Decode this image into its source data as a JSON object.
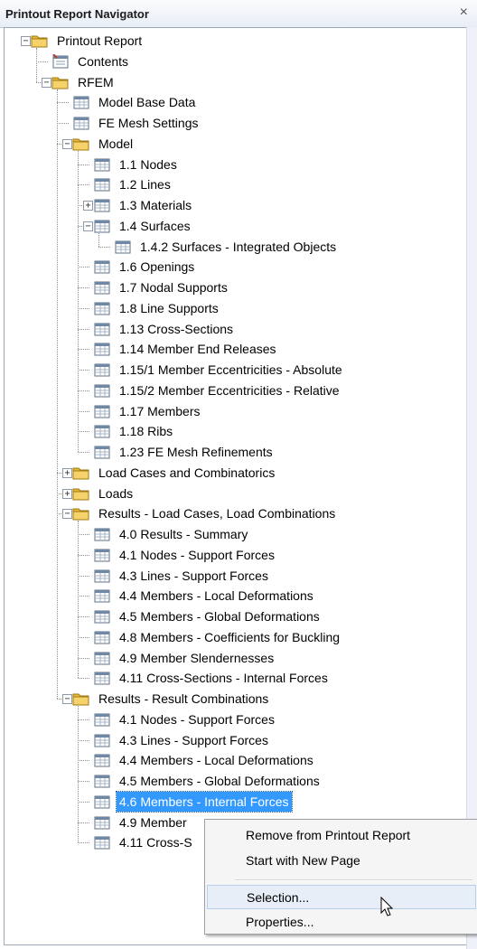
{
  "window": {
    "title": "Printout Report Navigator",
    "close_glyph": "×"
  },
  "tree": [
    {
      "label": "Printout Report",
      "icon": "folder-icon",
      "level": 0,
      "expander": "−"
    },
    {
      "label": "Contents",
      "icon": "contents-icon",
      "level": 1
    },
    {
      "label": "RFEM",
      "icon": "folder-icon",
      "level": 1,
      "expander": "−"
    },
    {
      "label": "Model Base Data",
      "icon": "table-icon",
      "level": 2
    },
    {
      "label": "FE Mesh Settings",
      "icon": "table-icon",
      "level": 2
    },
    {
      "label": "Model",
      "icon": "folder-icon",
      "level": 2,
      "expander": "−"
    },
    {
      "label": "1.1 Nodes",
      "icon": "table-icon",
      "level": 3
    },
    {
      "label": "1.2 Lines",
      "icon": "table-icon",
      "level": 3
    },
    {
      "label": "1.3 Materials",
      "icon": "table-icon",
      "level": 3,
      "expander": "+"
    },
    {
      "label": "1.4 Surfaces",
      "icon": "table-icon",
      "level": 3,
      "expander": "−"
    },
    {
      "label": "1.4.2 Surfaces - Integrated Objects",
      "icon": "table-icon",
      "level": 4
    },
    {
      "label": "1.6 Openings",
      "icon": "table-icon",
      "level": 3
    },
    {
      "label": "1.7 Nodal Supports",
      "icon": "table-icon",
      "level": 3
    },
    {
      "label": "1.8 Line Supports",
      "icon": "table-icon",
      "level": 3
    },
    {
      "label": "1.13 Cross-Sections",
      "icon": "table-icon",
      "level": 3
    },
    {
      "label": "1.14 Member End Releases",
      "icon": "table-icon",
      "level": 3
    },
    {
      "label": "1.15/1 Member Eccentricities - Absolute",
      "icon": "table-icon",
      "level": 3
    },
    {
      "label": "1.15/2 Member Eccentricities - Relative",
      "icon": "table-icon",
      "level": 3
    },
    {
      "label": "1.17 Members",
      "icon": "table-icon",
      "level": 3
    },
    {
      "label": "1.18 Ribs",
      "icon": "table-icon",
      "level": 3
    },
    {
      "label": "1.23 FE Mesh Refinements",
      "icon": "table-icon",
      "level": 3
    },
    {
      "label": "Load Cases and Combinatorics",
      "icon": "folder-icon",
      "level": 2,
      "expander": "+"
    },
    {
      "label": "Loads",
      "icon": "folder-icon",
      "level": 2,
      "expander": "+"
    },
    {
      "label": "Results - Load Cases, Load Combinations",
      "icon": "folder-icon",
      "level": 2,
      "expander": "−"
    },
    {
      "label": "4.0 Results - Summary",
      "icon": "table-icon",
      "level": 3
    },
    {
      "label": "4.1 Nodes - Support Forces",
      "icon": "table-icon",
      "level": 3
    },
    {
      "label": "4.3 Lines - Support Forces",
      "icon": "table-icon",
      "level": 3
    },
    {
      "label": "4.4 Members - Local Deformations",
      "icon": "table-icon",
      "level": 3
    },
    {
      "label": "4.5 Members - Global Deformations",
      "icon": "table-icon",
      "level": 3
    },
    {
      "label": "4.8 Members - Coefficients for Buckling",
      "icon": "table-icon",
      "level": 3
    },
    {
      "label": "4.9 Member Slendernesses",
      "icon": "table-icon",
      "level": 3
    },
    {
      "label": "4.11 Cross-Sections - Internal Forces",
      "icon": "table-icon",
      "level": 3
    },
    {
      "label": "Results - Result Combinations",
      "icon": "folder-icon",
      "level": 2,
      "expander": "−"
    },
    {
      "label": "4.1 Nodes - Support Forces",
      "icon": "table-icon",
      "level": 3
    },
    {
      "label": "4.3 Lines - Support Forces",
      "icon": "table-icon",
      "level": 3
    },
    {
      "label": "4.4 Members - Local Deformations",
      "icon": "table-icon",
      "level": 3
    },
    {
      "label": "4.5 Members - Global Deformations",
      "icon": "table-icon",
      "level": 3
    },
    {
      "label": "4.6 Members - Internal Forces",
      "icon": "table-icon",
      "level": 3,
      "selected": true
    },
    {
      "label": "4.9 Member",
      "icon": "table-icon",
      "level": 3
    },
    {
      "label": "4.11 Cross-S",
      "icon": "table-icon",
      "level": 3
    }
  ],
  "context_menu": {
    "remove": "Remove from Printout Report",
    "new_page": "Start with New Page",
    "selection": "Selection...",
    "properties": "Properties..."
  },
  "colors": {
    "selection": "#3399ff",
    "folder": "#f0c040",
    "menu_highlight": "#e7eef7"
  }
}
